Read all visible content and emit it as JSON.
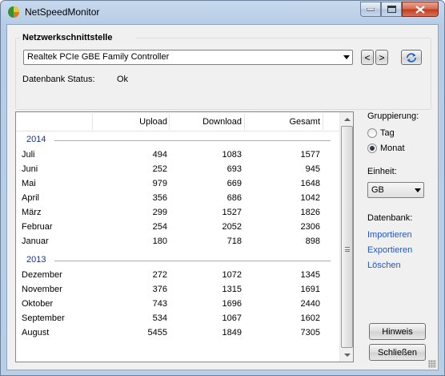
{
  "window": {
    "title": "NetSpeedMonitor"
  },
  "colors": {
    "accent_link": "#1f57c3",
    "year_header": "#1e3287",
    "close_button": "#c2391b"
  },
  "icons": {
    "app": "netspeedmonitor-app-icon",
    "refresh": "refresh-icon"
  },
  "interface_group": {
    "title": "Netzwerkschnittstelle",
    "adapter_selected": "Realtek PCIe GBE Family Controller",
    "prev_label": "<",
    "next_label": ">",
    "status_label": "Datenbank Status:",
    "status_value": "Ok"
  },
  "table": {
    "columns": [
      "",
      "Upload",
      "Download",
      "Gesamt"
    ],
    "groups": [
      {
        "year": "2014",
        "rows": [
          {
            "name": "Juli",
            "upload": "494",
            "download": "1083",
            "total": "1577"
          },
          {
            "name": "Juni",
            "upload": "252",
            "download": "693",
            "total": "945"
          },
          {
            "name": "Mai",
            "upload": "979",
            "download": "669",
            "total": "1648"
          },
          {
            "name": "April",
            "upload": "356",
            "download": "686",
            "total": "1042"
          },
          {
            "name": "März",
            "upload": "299",
            "download": "1527",
            "total": "1826"
          },
          {
            "name": "Februar",
            "upload": "254",
            "download": "2052",
            "total": "2306"
          },
          {
            "name": "Januar",
            "upload": "180",
            "download": "718",
            "total": "898"
          }
        ]
      },
      {
        "year": "2013",
        "rows": [
          {
            "name": "Dezember",
            "upload": "272",
            "download": "1072",
            "total": "1345"
          },
          {
            "name": "November",
            "upload": "376",
            "download": "1315",
            "total": "1691"
          },
          {
            "name": "Oktober",
            "upload": "743",
            "download": "1696",
            "total": "2440"
          },
          {
            "name": "September",
            "upload": "534",
            "download": "1067",
            "total": "1602"
          },
          {
            "name": "August",
            "upload": "5455",
            "download": "1849",
            "total": "7305"
          }
        ]
      }
    ]
  },
  "side": {
    "grouping_label": "Gruppierung:",
    "grouping_options": [
      "Tag",
      "Monat"
    ],
    "grouping_selected": "Monat",
    "unit_label": "Einheit:",
    "unit_selected": "GB",
    "db_label": "Datenbank:",
    "db_links": [
      "Importieren",
      "Exportieren",
      "Löschen"
    ],
    "help_button": "Hinweis",
    "close_button": "Schließen"
  }
}
